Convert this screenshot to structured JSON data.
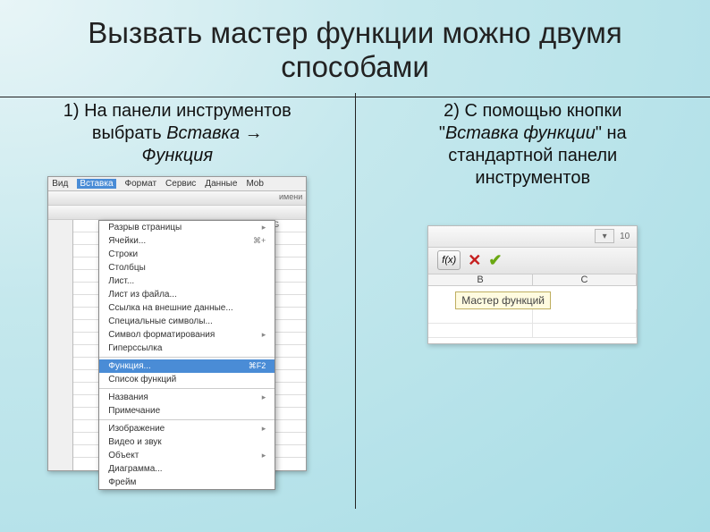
{
  "title": "Вызвать мастер функции можно двумя способами",
  "col1": {
    "desc_l1": "1) На панели инструментов",
    "desc_l2": "выбрать ",
    "desc_l3": "Вставка →",
    "desc_l4": "Функция",
    "menubar": {
      "m1": "Вид",
      "m2": "Вставка",
      "m3": "Формат",
      "m4": "Сервис",
      "m5": "Данные",
      "m6": "Mob"
    },
    "toolbar_label": "имени",
    "spreadsheet_col": "G",
    "dropdown": {
      "i1": "Разрыв страницы",
      "i2": "Ячейки...",
      "i2_kb": "⌘+",
      "i3": "Строки",
      "i4": "Столбцы",
      "i5": "Лист...",
      "i6": "Лист из файла...",
      "i7": "Ссылка на внешние данные...",
      "i8": "Специальные символы...",
      "i9": "Символ форматирования",
      "i10": "Гиперссылка",
      "i11": "Функция...",
      "i11_kb": "⌘F2",
      "i12": "Список функций",
      "i13": "Названия",
      "i14": "Примечание",
      "i15": "Изображение",
      "i16": "Видео и звук",
      "i17": "Объект",
      "i18": "Диаграмма...",
      "i19": "Фрейм"
    }
  },
  "col2": {
    "desc_l1": "2) С помощью кнопки",
    "desc_l2_q": "\"",
    "desc_l2_i": "Вставка функции",
    "desc_l2_e": "\" на",
    "desc_l3": "стандартной панели",
    "desc_l4": "инструментов",
    "tb_value": "10",
    "fx_label": "f(x)",
    "headers": {
      "b": "B",
      "c": "C"
    },
    "tooltip": "Мастер функций"
  }
}
